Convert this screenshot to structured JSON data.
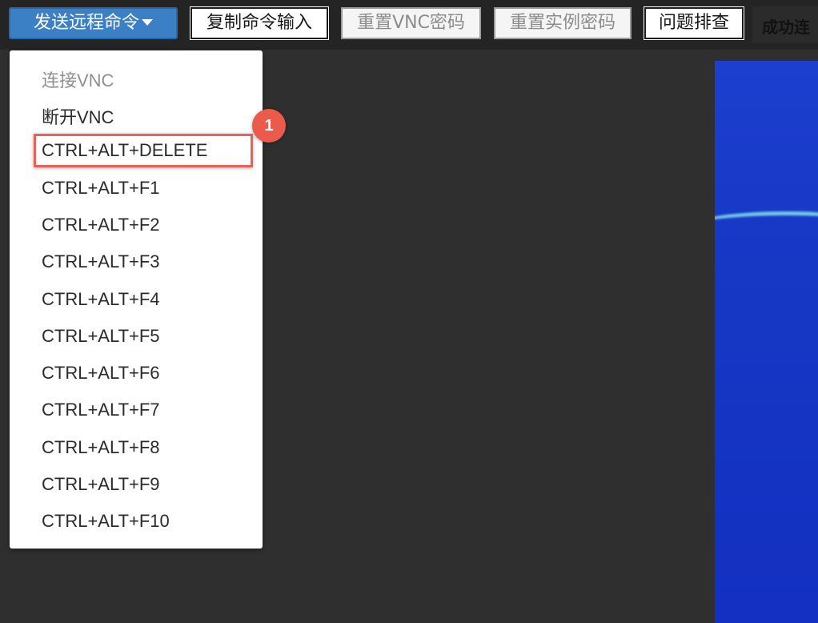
{
  "toolbar": {
    "send_command_label": "发送远程命令",
    "copy_command_label": "复制命令输入",
    "reset_vnc_password_label": "重置VNC密码",
    "reset_instance_password_label": "重置实例密码",
    "troubleshoot_label": "问题排查",
    "status_text": "成功连"
  },
  "dropdown": {
    "items": [
      {
        "label": "连接VNC",
        "disabled": true
      },
      {
        "label": "断开VNC"
      },
      {
        "label": "CTRL+ALT+DELETE",
        "highlighted": true
      },
      {
        "label": "CTRL+ALT+F1"
      },
      {
        "label": "CTRL+ALT+F2"
      },
      {
        "label": "CTRL+ALT+F3"
      },
      {
        "label": "CTRL+ALT+F4"
      },
      {
        "label": "CTRL+ALT+F5"
      },
      {
        "label": "CTRL+ALT+F6"
      },
      {
        "label": "CTRL+ALT+F7"
      },
      {
        "label": "CTRL+ALT+F8"
      },
      {
        "label": "CTRL+ALT+F9"
      },
      {
        "label": "CTRL+ALT+F10"
      }
    ]
  },
  "annotation": {
    "step_number": "1"
  },
  "colors": {
    "primary_button": "#3b7fc4",
    "highlight": "#e8615a",
    "background": "#2f2f2f",
    "remote_desktop": "#1637c4"
  }
}
